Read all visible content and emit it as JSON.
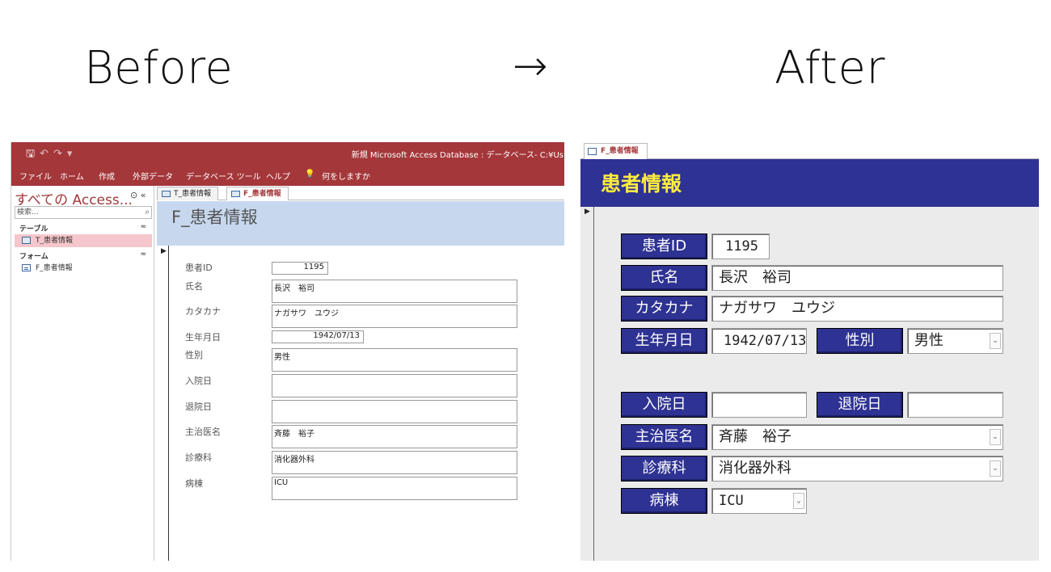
{
  "headings": {
    "before": "Before",
    "arrow": "→",
    "after": "After"
  },
  "before": {
    "title_bar": {
      "doc_title": "新規 Microsoft Access Database : データベース- C:¥Us"
    },
    "menu": [
      "ファイル",
      "ホーム",
      "作成",
      "外部データ",
      "データベース ツール",
      "ヘルプ",
      "何をしますか"
    ],
    "nav": {
      "title": "すべての Access...",
      "search_placeholder": "検索...",
      "groups": [
        {
          "label": "テーブル",
          "items": [
            "T_患者情報"
          ]
        },
        {
          "label": "フォーム",
          "items": [
            "F_患者情報"
          ]
        }
      ]
    },
    "tabs": [
      "T_患者情報",
      "F_患者情報"
    ],
    "form_title": "F_患者情報",
    "fields": [
      {
        "label": "患者ID",
        "value": "1195"
      },
      {
        "label": "氏名",
        "value": "長沢　裕司"
      },
      {
        "label": "カタカナ",
        "value": "ナガサワ　ユウジ"
      },
      {
        "label": "生年月日",
        "value": "1942/07/13"
      },
      {
        "label": "性別",
        "value": "男性"
      },
      {
        "label": "入院日",
        "value": ""
      },
      {
        "label": "退院日",
        "value": ""
      },
      {
        "label": "主治医名",
        "value": "斉藤　裕子"
      },
      {
        "label": "診療科",
        "value": "消化器外科"
      },
      {
        "label": "病棟",
        "value": "ICU"
      }
    ]
  },
  "after": {
    "tab": "F_患者情報",
    "header_title": "患者情報",
    "fields": [
      {
        "label": "患者ID",
        "value": "1195"
      },
      {
        "label": "氏名",
        "value": "長沢　裕司"
      },
      {
        "label": "カタカナ",
        "value": "ナガサワ　ユウジ"
      },
      {
        "label": "生年月日",
        "value": "1942/07/13"
      },
      {
        "label": "性別",
        "value": "男性"
      },
      {
        "label": "入院日",
        "value": ""
      },
      {
        "label": "退院日",
        "value": ""
      },
      {
        "label": "主治医名",
        "value": "斉藤　裕子"
      },
      {
        "label": "診療科",
        "value": "消化器外科"
      },
      {
        "label": "病棟",
        "value": "ICU"
      }
    ]
  },
  "colors": {
    "access_red": "#a4373a",
    "header_blue": "#2e3293",
    "header_yellow": "#ffec3d",
    "form_head_light_blue": "#c7d8ee",
    "nav_selected_pink": "#f5c6cb"
  }
}
